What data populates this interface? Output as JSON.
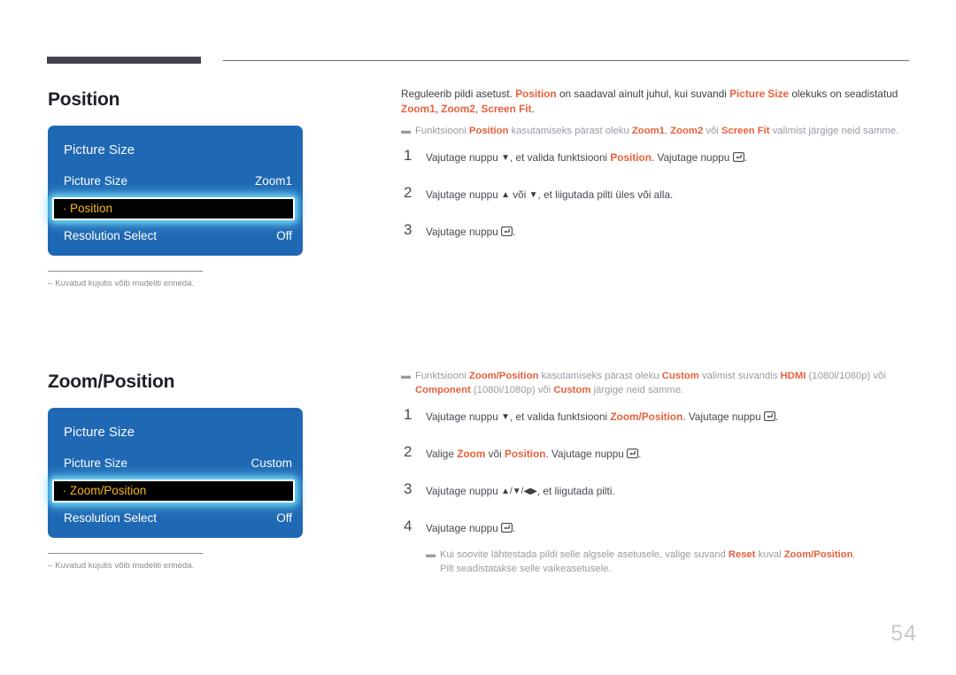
{
  "page": {
    "number": "54"
  },
  "sections": [
    {
      "title": "Position",
      "osd": {
        "header": "Picture Size",
        "rows": [
          {
            "label": "Picture Size",
            "value": "Zoom1",
            "selected": false
          },
          {
            "label": "Position",
            "value": "",
            "selected": true
          },
          {
            "label": "Resolution Select",
            "value": "Off",
            "selected": false
          }
        ]
      },
      "caption": "Kuvatud kujutis võib mudeliti erineda.",
      "intro": {
        "t1": "Reguleerib pildi asetust. ",
        "h1": "Position",
        "t2": " on saadaval ainult juhul, kui suvandi ",
        "h2": "Picture Size",
        "t3": " olekuks on seadistatud ",
        "h3": "Zoom1",
        "t4": ", ",
        "h4": "Zoom2",
        "t5": ", ",
        "h5": "Screen Fit",
        "t6": "."
      },
      "note": {
        "t1": "Funktsiooni ",
        "h1": "Position",
        "t2": " kasutamiseks pärast oleku ",
        "h2": "Zoom1",
        "t3": ", ",
        "h3": "Zoom2",
        "t4": " või ",
        "h4": "Screen Fit",
        "t5": " valimist järgige neid samme."
      },
      "steps": [
        {
          "num": "1",
          "t1": "Vajutage nuppu ",
          "g1": "▼",
          "t2": ", et valida funktsiooni ",
          "h1": "Position",
          "t3": ". Vajutage nuppu ",
          "key": "enter-key",
          "t4": "."
        },
        {
          "num": "2",
          "t1": "Vajutage nuppu ",
          "g1": "▲",
          "t2": " või ",
          "g2": "▼",
          "t3": ", et liigutada pilti üles või alla.",
          "h1": "",
          "t4": ""
        },
        {
          "num": "3",
          "t1": "Vajutage nuppu ",
          "g1": "",
          "t2": "",
          "h1": "",
          "t3": "",
          "key": "enter-key",
          "t4": "."
        }
      ]
    },
    {
      "title": "Zoom/Position",
      "osd": {
        "header": "Picture Size",
        "rows": [
          {
            "label": "Picture Size",
            "value": "Custom",
            "selected": false
          },
          {
            "label": "Zoom/Position",
            "value": "",
            "selected": true
          },
          {
            "label": "Resolution Select",
            "value": "Off",
            "selected": false
          }
        ]
      },
      "caption": "Kuvatud kujutis võib mudeliti erineda.",
      "note": {
        "t1": "Funktsiooni ",
        "h1": "Zoom/Position",
        "t2": " kasutamiseks pärast oleku ",
        "h2": "Custom",
        "t3": " valimist suvandis ",
        "h3": "HDMI",
        "t4": " (1080i/1080p) või ",
        "h4": "Component",
        "t5": " (1080i/1080p) või ",
        "h5": "Custom",
        "t6": " järgige neid samme."
      },
      "steps": [
        {
          "num": "1",
          "t1": "Vajutage nuppu ",
          "g1": "▼",
          "t2": ", et valida funktsiooni ",
          "h1": "Zoom/Position",
          "t3": ". Vajutage nuppu ",
          "key": "enter-key",
          "t4": "."
        },
        {
          "num": "2",
          "t1": "Valige ",
          "h1": "Zoom",
          "t2": " või ",
          "h2": "Position",
          "t3": ". Vajutage nuppu ",
          "key": "enter-key",
          "t4": "."
        },
        {
          "num": "3",
          "t1": "Vajutage nuppu ",
          "g1": "▲",
          "s1": "/",
          "g2": "▼",
          "s2": "/",
          "g3": "◀",
          "g4": "▶",
          "t2": ", et liigutada pilti."
        },
        {
          "num": "4",
          "t1": "Vajutage nuppu ",
          "key": "enter-key",
          "t4": "."
        }
      ],
      "subnote": {
        "t1": "Kui soovite lähtestada pildi selle algsele asetusele, valige suvand ",
        "h1": "Reset",
        "t2": " kuval ",
        "h2": "Zoom/Position",
        "t3": ".",
        "t4": "Pilt seadistatakse selle vaikeasetusele."
      }
    }
  ],
  "colors": {
    "accent_orange": "#e8603c",
    "osd_blue": "#1f68b4",
    "highlight_text": "#f7b519",
    "glow": "#6fd6f5",
    "rule_dark": "#454250"
  }
}
